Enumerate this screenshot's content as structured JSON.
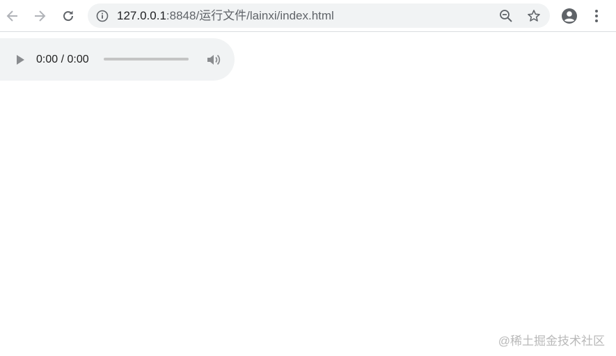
{
  "browser": {
    "url_host": "127.0.0.1",
    "url_rest": ":8848/运行文件/lainxi/index.html",
    "icons": {
      "back": "back-arrow-icon",
      "forward": "forward-arrow-icon",
      "reload": "reload-icon",
      "site_info": "info-icon",
      "zoom": "zoom-out-icon",
      "bookmark": "star-icon",
      "profile": "account-icon",
      "menu": "kebab-menu-icon"
    }
  },
  "audio_player": {
    "time": "0:00 / 0:00",
    "progress_fraction": 0,
    "icons": {
      "play": "play-icon",
      "volume": "volume-icon"
    }
  },
  "watermark": "@稀土掘金技术社区",
  "colors": {
    "toolbar_bg": "#ffffff",
    "omnibox_bg": "#f1f3f4",
    "icon": "#5f6368",
    "player_bg": "#f1f3f4"
  }
}
